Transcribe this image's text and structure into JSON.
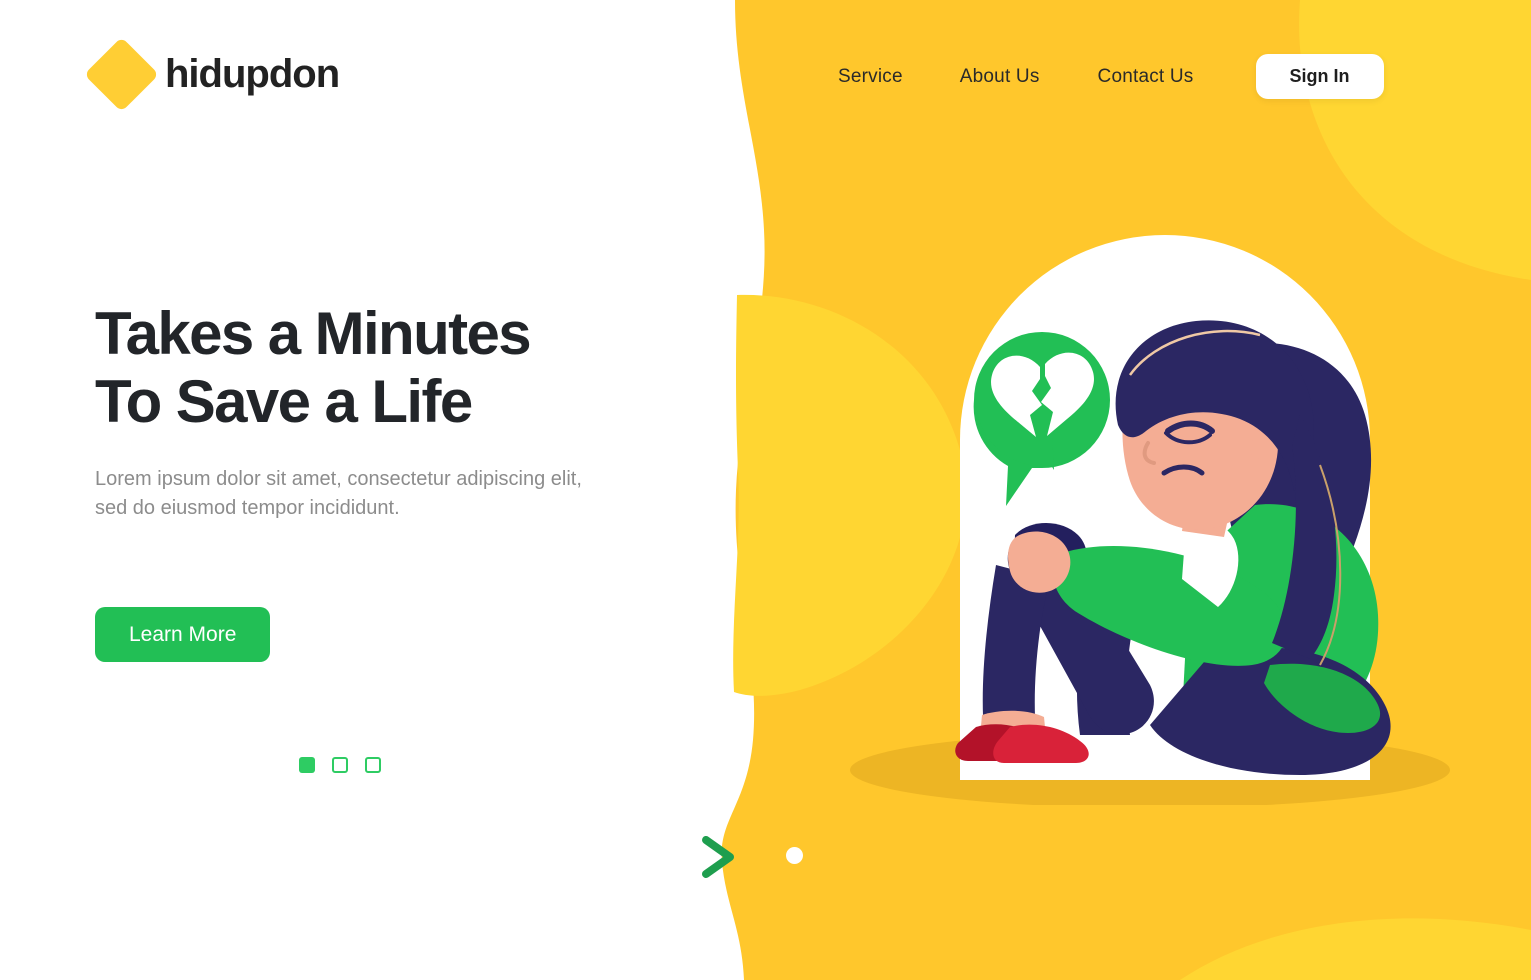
{
  "brand": {
    "name": "hidupdon",
    "logo_icon": "yellow-diamond-icon"
  },
  "nav": {
    "links": [
      {
        "label": "Service"
      },
      {
        "label": "About Us"
      },
      {
        "label": "Contact Us"
      }
    ],
    "signin_label": "Sign In"
  },
  "hero": {
    "title_line1": "Takes a Minutes",
    "title_line2": "To Save a Life",
    "subtitle": "Lorem ipsum dolor sit amet, consectetur adipiscing elit, sed do eiusmod tempor incididunt.",
    "cta_label": "Learn More"
  },
  "slider": {
    "indicators": [
      {
        "state": "active"
      },
      {
        "state": "inactive"
      },
      {
        "state": "inactive"
      }
    ],
    "next_icon": "chevron-right-icon",
    "dot_icon": "slide-dot-icon"
  },
  "illustration": {
    "alt": "sad-woman-sitting-illustration",
    "bubble_icon": "broken-heart-speech-bubble-icon"
  },
  "colors": {
    "yellow_base": "#FFC72C",
    "yellow_light": "#FFD632",
    "yellow_shadow": "#EDB524",
    "green": "#22BF55",
    "green_bright": "#2ECC63",
    "green_arrow": "#1E9E4E",
    "navy": "#2B2763",
    "navy_dark": "#231F5E",
    "skin": "#F4AD94",
    "red": "#D92239",
    "text_dark": "#222529",
    "text_muted": "#8c8c8c",
    "white": "#FFFFFF"
  }
}
